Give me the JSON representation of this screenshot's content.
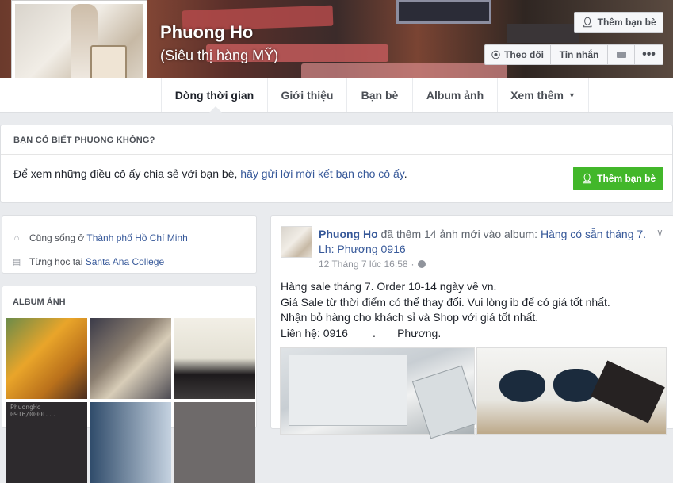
{
  "profile": {
    "name": "Phuong Ho",
    "alternate_name": "(Siêu thị hàng MỸ)"
  },
  "cover_actions": {
    "add_friend": "Thêm bạn bè",
    "follow": "Theo dõi",
    "message": "Tin nhắn"
  },
  "nav": {
    "tabs": [
      "Dòng thời gian",
      "Giới thiệu",
      "Bạn bè",
      "Album ảnh",
      "Xem thêm"
    ]
  },
  "know_card": {
    "title": "BẠN CÓ BIẾT PHUONG KHÔNG?",
    "text_prefix": "Để xem những điều cô ấy chia sẻ với bạn bè, ",
    "link": "hãy gửi lời mời kết bạn cho cô ấy",
    "text_suffix": ".",
    "button": "Thêm bạn bè"
  },
  "intro": {
    "lives_label": "Cũng sống ở ",
    "lives_place": "Thành phố Hồ Chí Minh",
    "studied_label": "Từng học tại ",
    "studied_place": "Santa Ana College"
  },
  "albums": {
    "title": "ALBUM ẢNH",
    "photo_caption": "PhuongHo 0916/0000..."
  },
  "post": {
    "author": "Phuong Ho",
    "action": " đã thêm 14 ảnh mới vào album: ",
    "album": "Hàng có sẵn tháng 7. Lh: Phương 0916",
    "time": "12 Tháng 7 lúc 16:58",
    "lines": [
      "Hàng sale tháng 7. Order 10-14 ngày về vn.",
      "Giá Sale từ thời điểm có thể thay đổi. Vui lòng ib để có giá tốt nhất.",
      "Nhận bỏ hàng cho khách sỉ và Shop với giá tốt nhất.",
      "Liên hệ: 0916        .       Phương."
    ]
  }
}
